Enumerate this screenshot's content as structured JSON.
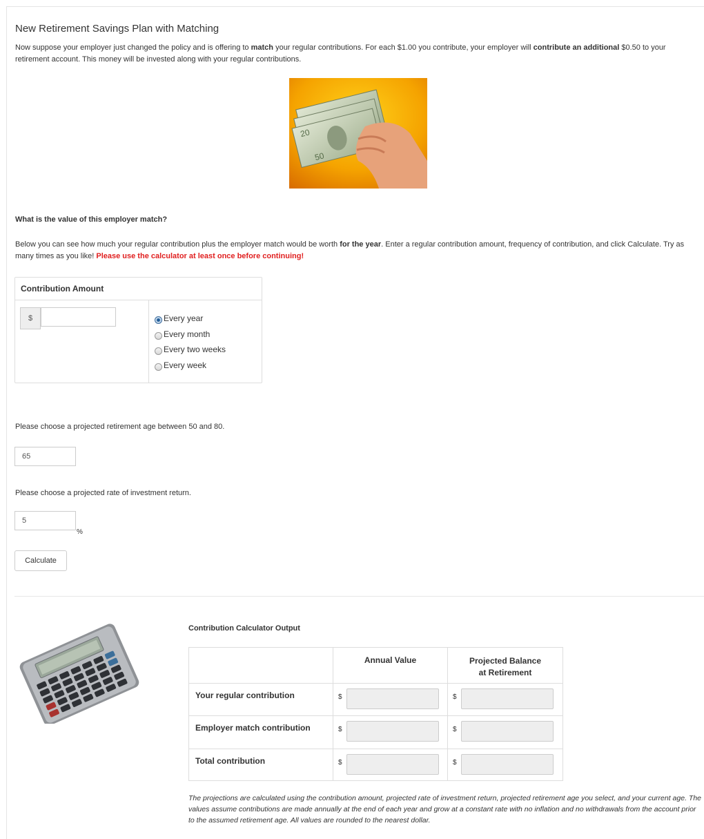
{
  "page": {
    "title": "New Retirement Savings Plan with Matching",
    "intro": {
      "p1": "Now suppose your employer just changed the policy and is offering to ",
      "b1": "match",
      "p2": " your regular contributions. For each $1.00 you contribute, your employer will ",
      "b2": "contribute an additional",
      "p3": " $0.50 to your retirement account. This money will be invested along with your regular contributions."
    },
    "question_heading": "What is the value of this employer match?",
    "below": {
      "p1": "Below you can see how much your regular contribution plus the employer match would be worth ",
      "b1": "for the year",
      "p2": ". Enter a regular contribution amount, frequency of contribution, and click Calculate. Try as many times as you like! ",
      "red": "Please use the calculator at least once before continuing!"
    }
  },
  "contribution_panel": {
    "heading": "Contribution Amount",
    "currency_symbol": "$",
    "amount_value": "",
    "frequency_options": [
      "Every year",
      "Every month",
      "Every two weeks",
      "Every week"
    ],
    "selected_frequency": "Every year"
  },
  "retirement_age": {
    "prompt": "Please choose a projected retirement age between 50 and 80.",
    "value": "65"
  },
  "rate": {
    "prompt": "Please choose a projected rate of investment return.",
    "value": "5",
    "unit": "%"
  },
  "calculate_button": "Calculate",
  "output": {
    "title": "Contribution Calculator Output",
    "columns": [
      "",
      "Annual Value",
      "Projected Balance at Retirement"
    ],
    "rows": [
      {
        "label": "Your regular contribution",
        "annual": "",
        "projected": ""
      },
      {
        "label": "Employer match contribution",
        "annual": "",
        "projected": ""
      },
      {
        "label": "Total contribution",
        "annual": "",
        "projected": ""
      }
    ],
    "currency_symbol": "$",
    "note": "The projections are calculated using the contribution amount, projected rate of investment return, projected retirement age you select, and your current age. The values assume contributions are made annually at the end of each year and grow at a constant rate with no inflation and no withdrawals from the account prior to the assumed retirement age. All values are rounded to the nearest dollar."
  },
  "icons": {
    "money_image": "cash-in-hand-photo",
    "calculator_image": "calculator-photo",
    "accent": "#1f5a96",
    "warning": "#e02020"
  }
}
